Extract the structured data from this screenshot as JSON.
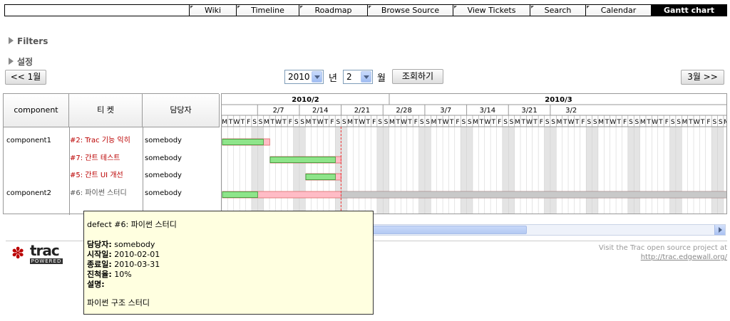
{
  "nav": {
    "items": [
      {
        "label": "Wiki",
        "width": 66
      },
      {
        "label": "Timeline",
        "width": 88
      },
      {
        "label": "Roadmap",
        "width": 96
      },
      {
        "label": "Browse Source",
        "width": 120
      },
      {
        "label": "View Tickets",
        "width": 108
      },
      {
        "label": "Search",
        "width": 78
      },
      {
        "label": "Calendar",
        "width": 92
      },
      {
        "label": "Gantt chart",
        "width": 106
      }
    ],
    "active": "Gantt chart"
  },
  "filters": {
    "label": "Filters"
  },
  "settings": {
    "label": "설정"
  },
  "controls": {
    "prev_label": "<< 1월",
    "next_label": "3월 >>",
    "year_value": "2010",
    "year_unit": "년",
    "month_value": "2",
    "month_unit": "월",
    "query_label": "조회하기"
  },
  "table": {
    "headers": {
      "component": "component",
      "ticket": "티 켓",
      "owner": "담당자"
    },
    "rows": [
      {
        "component": "component1",
        "ticket": "#2: Trac 기능 익히",
        "owner": "somebody",
        "closed": false
      },
      {
        "component": "",
        "ticket": "#7: 간트 테스트",
        "owner": "somebody",
        "closed": false
      },
      {
        "component": "",
        "ticket": "#5: 간트 UI 개선",
        "owner": "somebody",
        "closed": false
      },
      {
        "component": "component2",
        "ticket": "#6: 파이썬 스터디",
        "owner": "somebody",
        "closed": true
      }
    ]
  },
  "chart_data": {
    "type": "gantt",
    "months": [
      "2010/2",
      "2010/3"
    ],
    "weeks": [
      "2/7",
      "2/14",
      "2/21",
      "2/28",
      "3/7",
      "3/14",
      "3/21",
      "3/2"
    ],
    "day_letters": [
      "M",
      "T",
      "W",
      "T",
      "F",
      "S",
      "S"
    ],
    "start_weekday_letters": [
      "M",
      "T",
      "W",
      "T",
      "F",
      "S",
      "S"
    ],
    "today": "2010-02-20",
    "tasks": [
      {
        "ticket": "#2",
        "start": "2010-02-01",
        "end": "2010-02-08",
        "done_until": "2010-02-07"
      },
      {
        "ticket": "#7",
        "start": "2010-02-09",
        "end": "2010-02-20",
        "done_until": "2010-02-19"
      },
      {
        "ticket": "#5",
        "start": "2010-02-15",
        "end": "2010-02-20",
        "done_until": "2010-02-19"
      },
      {
        "ticket": "#6",
        "start": "2010-02-01",
        "end": "2010-03-31",
        "done_until": "2010-02-06"
      }
    ]
  },
  "tooltip": {
    "title": "defect #6: 파이썬 스터디",
    "owner_label": "담당자:",
    "owner_value": "somebody",
    "start_label": "시작일:",
    "start_value": "2010-02-01",
    "end_label": "종료일:",
    "end_value": "2010-03-31",
    "progress_label": "진척율:",
    "progress_value": "10%",
    "desc_label": "설명:",
    "desc_value": "파이썬 구조 스터디"
  },
  "footer": {
    "visit_text": "Visit the Trac open source project at",
    "url": "http://trac.edgewall.org/",
    "logo_word": "trac",
    "logo_powered": "POWERED"
  }
}
